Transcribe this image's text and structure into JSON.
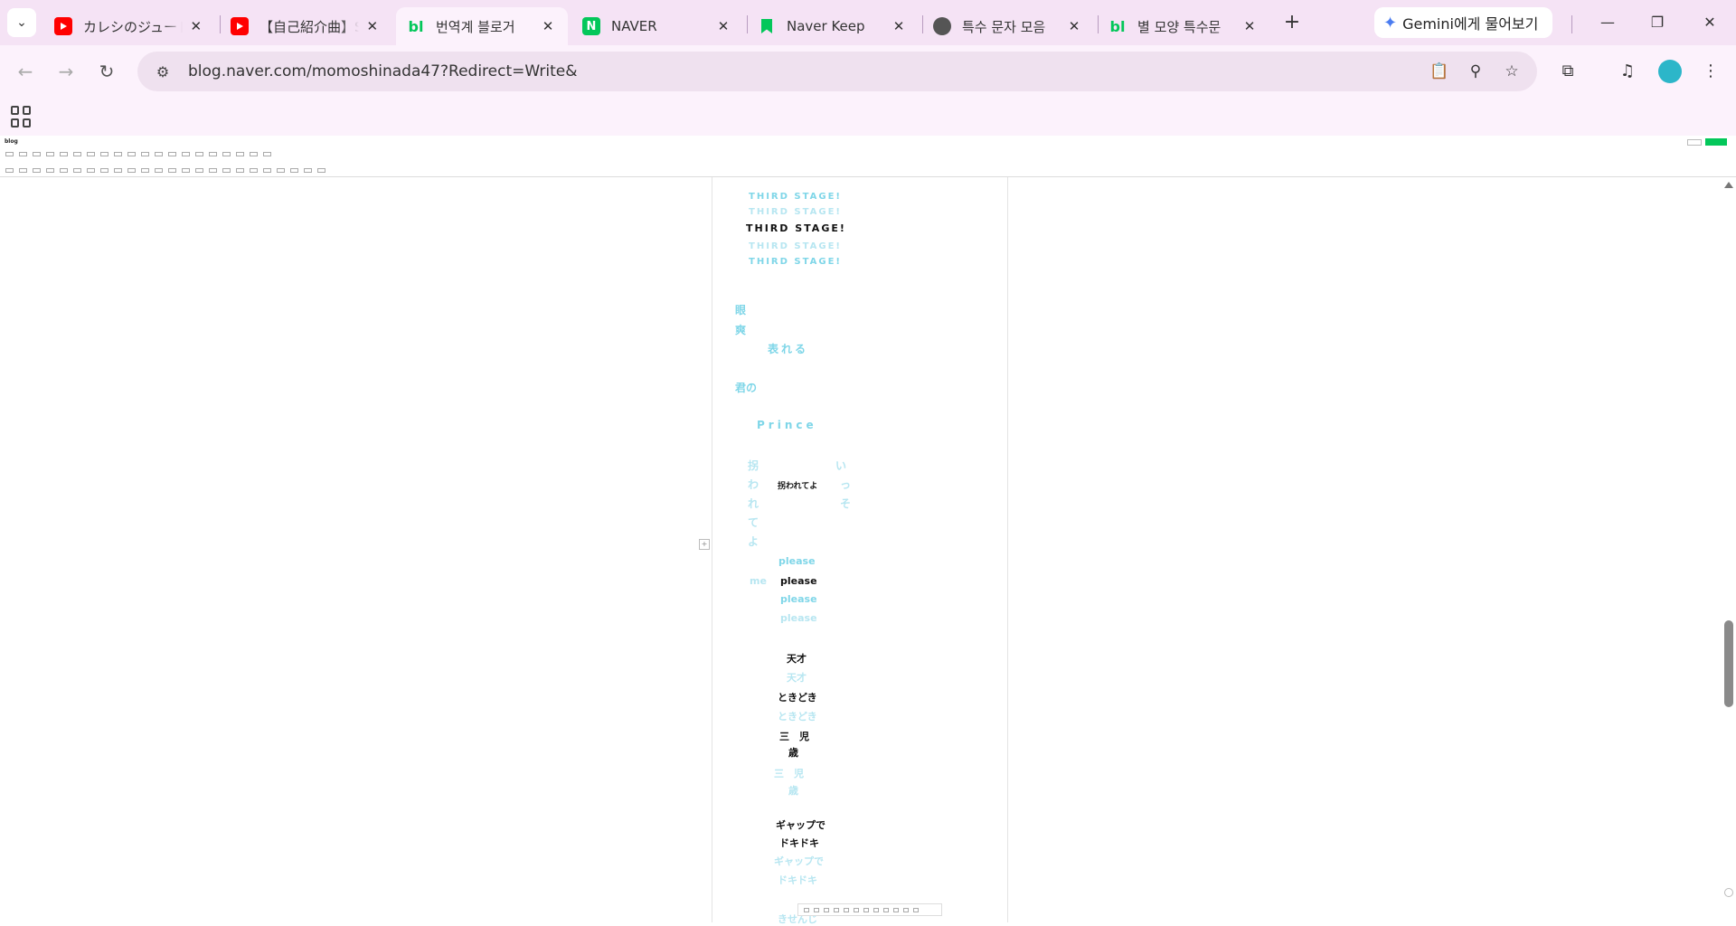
{
  "tabs": [
    {
      "title": "カレシのジュード",
      "favicon": "youtube-icon",
      "active": false
    },
    {
      "title": "【自己紹介曲】SI",
      "favicon": "youtube-icon",
      "active": false
    },
    {
      "title": "번역계 블로거 ",
      "favicon": "naver-blog-icon",
      "favicon_text": "bl",
      "active": true
    },
    {
      "title": "NAVER",
      "favicon": "naver-icon",
      "favicon_text": "N",
      "active": false
    },
    {
      "title": "Naver Keep",
      "favicon": "naver-keep-icon",
      "active": false
    },
    {
      "title": "특수 문자 모음",
      "favicon": "globe-icon",
      "active": false
    },
    {
      "title": "별 모양 특수문",
      "favicon": "naver-blog-icon",
      "favicon_text": "bl",
      "active": false
    }
  ],
  "gemini_label": "Gemini에게 물어보기",
  "address": "blog.naver.com/momoshinada47?Redirect=Write&",
  "editor": {
    "logo": "blog"
  },
  "doc_lines": [
    {
      "text": "THIRD STAGE!",
      "tone": "cyan"
    },
    {
      "text": "THIRD STAGE!",
      "tone": "light"
    },
    {
      "text": "THIRD STAGE!",
      "tone": "dark"
    },
    {
      "text": "THIRD STAGE!",
      "tone": "cyan"
    },
    {
      "text": "THIRD STAGE!",
      "tone": "cyan"
    },
    {
      "text": "眼",
      "tone": "cyan"
    },
    {
      "text": "爽",
      "tone": "cyan"
    },
    {
      "text": "表れる",
      "tone": "cyan"
    },
    {
      "text": "君の",
      "tone": "cyan"
    },
    {
      "text": "Prince",
      "tone": "cyan"
    },
    {
      "text": "拐",
      "tone": "light"
    },
    {
      "text": "わ",
      "tone": "light"
    },
    {
      "text": "れ",
      "tone": "light"
    },
    {
      "text": "て",
      "tone": "light"
    },
    {
      "text": "よ",
      "tone": "light"
    },
    {
      "text": "拐われてよ",
      "tone": "dark"
    },
    {
      "text": "い",
      "tone": "light"
    },
    {
      "text": "っ",
      "tone": "light"
    },
    {
      "text": "そ",
      "tone": "light"
    },
    {
      "text": "please",
      "tone": "cyan"
    },
    {
      "text": "me",
      "tone": "light"
    },
    {
      "text": "please",
      "tone": "dark"
    },
    {
      "text": "please",
      "tone": "cyan"
    },
    {
      "text": "please",
      "tone": "light"
    },
    {
      "text": "天才",
      "tone": "dark"
    },
    {
      "text": "天才",
      "tone": "light"
    },
    {
      "text": "ときどき",
      "tone": "dark"
    },
    {
      "text": "ときどき",
      "tone": "light"
    },
    {
      "text": "三　児",
      "tone": "dark"
    },
    {
      "text": "歳",
      "tone": "dark"
    },
    {
      "text": "三　児",
      "tone": "light"
    },
    {
      "text": "歳",
      "tone": "light"
    },
    {
      "text": "ギャップで",
      "tone": "dark"
    },
    {
      "text": "ドキドキ",
      "tone": "dark"
    },
    {
      "text": "ギャップで",
      "tone": "light"
    },
    {
      "text": "ドキドキ",
      "tone": "light"
    },
    {
      "text": "きせんじ",
      "tone": "light"
    }
  ],
  "colors": {
    "accent_cyan": "#7fd6e8",
    "light_cyan": "#b7e6f1",
    "naver_green": "#03c75a",
    "tab_strip": "#f5e3f5"
  }
}
